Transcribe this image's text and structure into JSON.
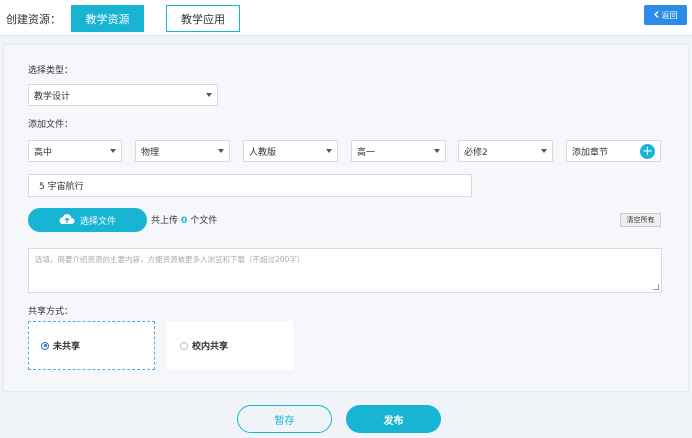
{
  "header": {
    "create_label": "创建资源：",
    "tabs": [
      {
        "label": "教学资源",
        "active": true
      },
      {
        "label": "教学应用",
        "active": false
      }
    ],
    "back_label": "返回"
  },
  "form": {
    "type_label": "选择类型：",
    "type_value": "教学设计",
    "file_label": "添加文件：",
    "selects": [
      {
        "value": "高中"
      },
      {
        "value": "物理"
      },
      {
        "value": "人教版"
      },
      {
        "value": "高一"
      },
      {
        "value": "必修2"
      }
    ],
    "add_chapter_label": "添加章节",
    "chapter_value": "5 宇宙航行",
    "upload_button_label": "选择文件",
    "upload_count_prefix": "共上传",
    "upload_count": "0",
    "upload_count_suffix": "个文件",
    "clear_all_label": "清空所有",
    "description_placeholder": "选填，简要介绍资源的主要内容，方便资源被更多人浏览和下载（不超过200字）",
    "share_label": "共享方式：",
    "share_options": [
      {
        "label": "未共享",
        "checked": true
      },
      {
        "label": "校内共享",
        "checked": false
      }
    ]
  },
  "footer": {
    "draft_label": "暂存",
    "publish_label": "发布"
  },
  "colors": {
    "accent": "#18b4d4",
    "back_button": "#2d8ce8",
    "background": "#f0f4f8"
  }
}
